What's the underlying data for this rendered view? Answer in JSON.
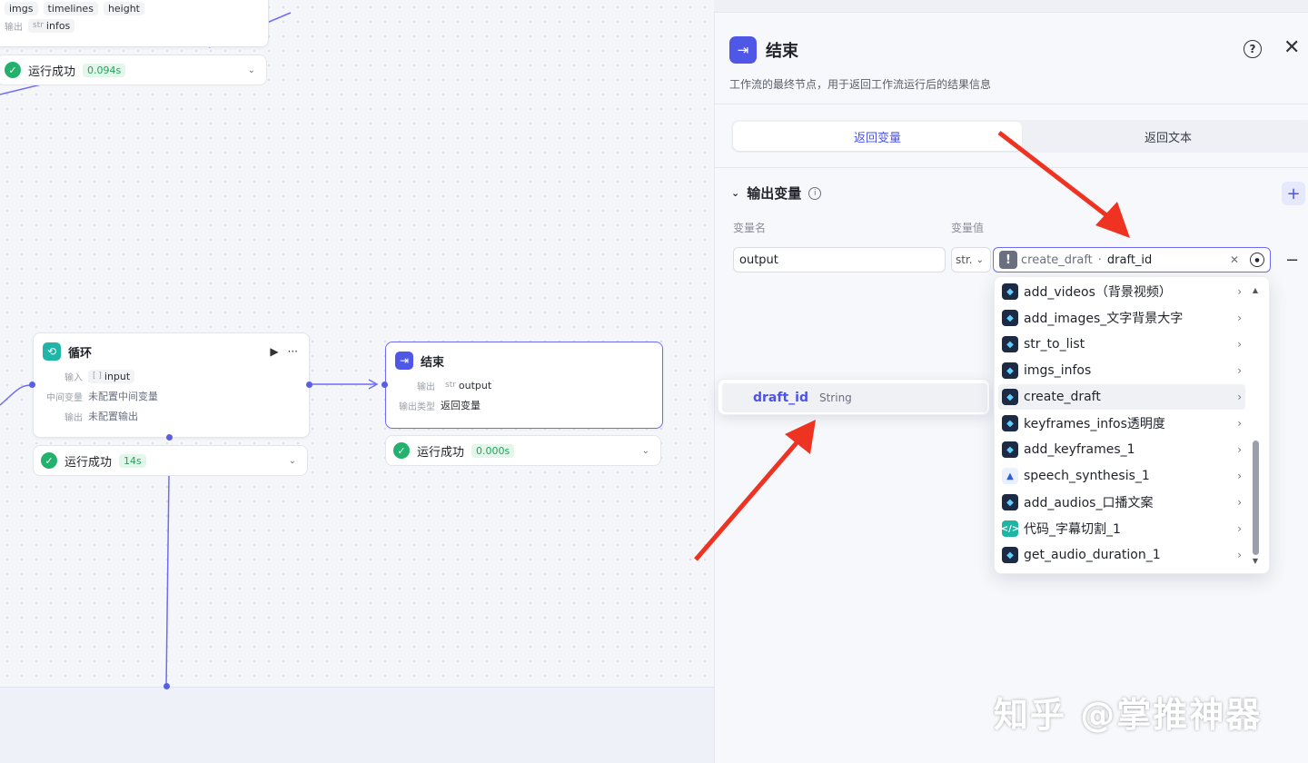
{
  "canvas": {
    "top_node": {
      "row_input_tags": [
        "imgs",
        "timelines",
        "height"
      ],
      "output_label": "输出",
      "output_type": "str",
      "output_var": "infos",
      "status": "运行成功",
      "time": "0.094s"
    },
    "loop_node": {
      "title": "循环",
      "input_label": "输入",
      "input_type": "[ ]",
      "input_var": "input",
      "mid_label": "中间变量",
      "mid_value": "未配置中间变量",
      "output_label": "输出",
      "output_value": "未配置输出",
      "status": "运行成功",
      "time": "14s"
    },
    "end_node": {
      "title": "结束",
      "output_label": "输出",
      "output_type": "str",
      "output_var": "output",
      "mode_label": "输出类型",
      "mode_value": "返回变量",
      "status": "运行成功",
      "time": "0.000s"
    }
  },
  "panel": {
    "title": "结束",
    "description": "工作流的最终节点，用于返回工作流运行后的结果信息",
    "tabs": [
      {
        "label": "返回变量",
        "active": true
      },
      {
        "label": "返回文本",
        "active": false
      }
    ],
    "section_title": "输出变量",
    "col_name": "变量名",
    "col_value": "变量值",
    "var_name": "output",
    "var_type": "str.",
    "ref_node": "create_draft",
    "ref_var": "draft_id"
  },
  "dropdown": {
    "items": [
      {
        "label": "add_videos（背景视频）",
        "icon": "plugin-icon"
      },
      {
        "label": "add_images_文字背景大字",
        "icon": "plugin-icon"
      },
      {
        "label": "str_to_list",
        "icon": "plugin-icon"
      },
      {
        "label": "imgs_infos",
        "icon": "plugin-icon"
      },
      {
        "label": "create_draft",
        "icon": "plugin-icon",
        "hover": true
      },
      {
        "label": "keyframes_infos透明度",
        "icon": "plugin-icon"
      },
      {
        "label": "add_keyframes_1",
        "icon": "plugin-icon"
      },
      {
        "label": "speech_synthesis_1",
        "icon": "speech-icon"
      },
      {
        "label": "add_audios_口播文案",
        "icon": "plugin-icon"
      },
      {
        "label": "代码_字幕切割_1",
        "icon": "code-icon"
      },
      {
        "label": "get_audio_duration_1",
        "icon": "plugin-icon"
      }
    ],
    "submenu": {
      "name": "draft_id",
      "type": "String"
    }
  },
  "watermark": "知乎 @掌推神器",
  "colors": {
    "accent": "#4d53e8",
    "success": "#23b26d",
    "arrow": "#ee3322"
  }
}
